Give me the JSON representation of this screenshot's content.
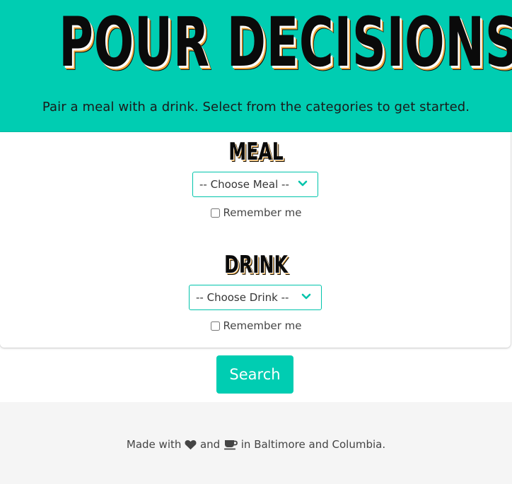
{
  "hero": {
    "title": "POUR DECISIONS",
    "tagline": "Pair a meal with a drink. Select from the categories to get started."
  },
  "meal": {
    "title": "MEAL",
    "select_value": "-- Choose Meal --",
    "remember_label": "Remember me"
  },
  "drink": {
    "title": "DRINK",
    "select_value": "-- Choose Drink --",
    "remember_label": "Remember me"
  },
  "search": {
    "label": "Search"
  },
  "footer": {
    "prefix": "Made with",
    "and": "and",
    "suffix": "in Baltimore and Columbia.",
    "icons": [
      "heart-icon",
      "coffee-icon"
    ]
  },
  "colors": {
    "accent": "#00cdb2",
    "title_shadow": "#f0a73a",
    "footer_bg": "#f5f5f5"
  }
}
